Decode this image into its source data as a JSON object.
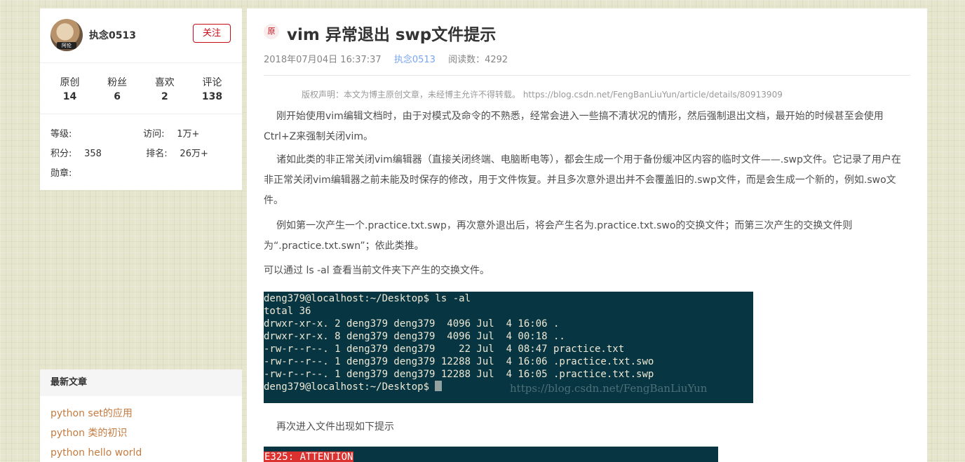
{
  "profile": {
    "username": "执念0513",
    "follow_label": "关注",
    "avatar_badge": "阿伦",
    "stats": [
      {
        "label": "原创",
        "value": "14"
      },
      {
        "label": "粉丝",
        "value": "6"
      },
      {
        "label": "喜欢",
        "value": "2"
      },
      {
        "label": "评论",
        "value": "138"
      }
    ],
    "grade_label": "等级:",
    "visits_label": "访问:",
    "visits_value": "1万+",
    "points_label": "积分:",
    "points_value": "358",
    "rank_label": "排名:",
    "rank_value": "26万+",
    "medal_label": "勋章:"
  },
  "recent": {
    "title": "最新文章",
    "items": [
      "python set的应用",
      "python 类的初识",
      "python hello world"
    ]
  },
  "article": {
    "orig_badge": "原",
    "title": "vim 异常退出 swp文件提示",
    "date": "2018年07月04日 16:37:37",
    "author": "执念0513",
    "reads": "阅读数：4292",
    "copyright": "版权声明：本文为博主原创文章，未经博主允许不得转载。 https://blog.csdn.net/FengBanLiuYun/article/details/80913909",
    "p1": "刚开始使用vim编辑文档时，由于对模式及命令的不熟悉，经常会进入一些搞不清状况的情形，然后强制退出文档，最开始的时候甚至会使用Ctrl+Z来强制关闭vim。",
    "p2": "诸如此类的非正常关闭vim编辑器（直接关闭终端、电脑断电等），都会生成一个用于备份缓冲区内容的临时文件——.swp文件。它记录了用户在非正常关闭vim编辑器之前未能及时保存的修改，用于文件恢复。并且多次意外退出并不会覆盖旧的.swp文件，而是会生成一个新的，例如.swo文件。",
    "p3": "例如第一次产生一个.practice.txt.swp，再次意外退出后，将会产生名为.practice.txt.swo的交换文件；而第三次产生的交换文件则为“.practice.txt.swn”；依此类推。",
    "p4": "可以通过 ls -al 查看当前文件夹下产生的交换文件。",
    "terminal_lines": [
      "deng379@localhost:~/Desktop$ ls -al",
      "total 36",
      "drwxr-xr-x. 2 deng379 deng379  4096 Jul  4 16:06 .",
      "drwxr-xr-x. 8 deng379 deng379  4096 Jul  4 00:18 ..",
      "-rw-r--r--. 1 deng379 deng379    22 Jul  4 08:47 practice.txt",
      "-rw-r--r--. 1 deng379 deng379 12288 Jul  4 16:06 .practice.txt.swo",
      "-rw-r--r--. 1 deng379 deng379 12288 Jul  4 16:05 .practice.txt.swp",
      "deng379@localhost:~/Desktop$ "
    ],
    "terminal_watermark": "https://blog.csdn.net/FengBanLiuYun",
    "p5": "再次进入文件出现如下提示",
    "terminal2_line": "E325: ATTENTION"
  }
}
